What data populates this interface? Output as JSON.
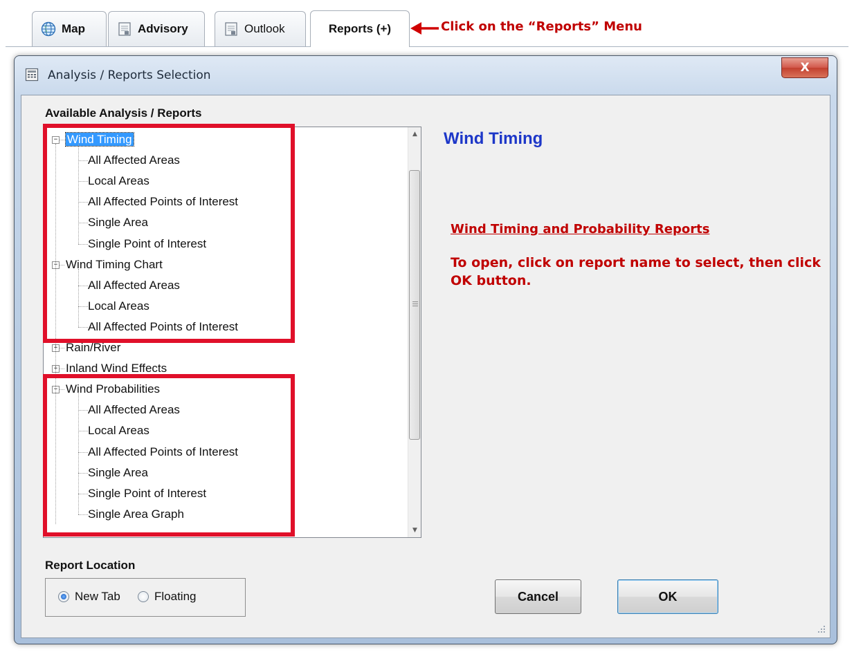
{
  "tabs": [
    {
      "label": "Map",
      "icon": "globe-icon",
      "bold": true
    },
    {
      "label": "Advisory",
      "icon": "document-icon",
      "bold": true
    },
    {
      "label": "Outlook",
      "icon": "document-icon",
      "bold": false
    },
    {
      "label": "Reports (+)",
      "icon": "",
      "bold": true,
      "active": true
    }
  ],
  "top_callout": "Click on the “Reports” Menu",
  "dialog": {
    "title": "Analysis / Reports Selection",
    "close_label": "X",
    "available_label": "Available Analysis / Reports",
    "tree": [
      {
        "label": "Wind Timing",
        "level": 0,
        "expander": "minus",
        "selected": true
      },
      {
        "label": "All Affected Areas",
        "level": 1
      },
      {
        "label": "Local Areas",
        "level": 1
      },
      {
        "label": "All Affected Points of Interest",
        "level": 1
      },
      {
        "label": "Single Area",
        "level": 1
      },
      {
        "label": "Single Point of Interest",
        "level": 1
      },
      {
        "label": "Wind Timing Chart",
        "level": 0,
        "expander": "minus"
      },
      {
        "label": "All Affected Areas",
        "level": 1
      },
      {
        "label": "Local Areas",
        "level": 1
      },
      {
        "label": "All Affected Points of Interest",
        "level": 1
      },
      {
        "label": "Rain/River",
        "level": 0,
        "expander": "plus"
      },
      {
        "label": "Inland Wind Effects",
        "level": 0,
        "expander": "plus"
      },
      {
        "label": "Wind Probabilities",
        "level": 0,
        "expander": "minus"
      },
      {
        "label": "All Affected Areas",
        "level": 1
      },
      {
        "label": "Local Areas",
        "level": 1
      },
      {
        "label": "All Affected Points of Interest",
        "level": 1
      },
      {
        "label": "Single Area",
        "level": 1
      },
      {
        "label": "Single Point of Interest",
        "level": 1
      },
      {
        "label": "Single Area Graph",
        "level": 1
      }
    ],
    "selected_report_title": "Wind Timing",
    "annotation_heading": "Wind Timing and Probability Reports",
    "annotation_body": "To open, click on report name to select, then click OK button.",
    "report_location_label": "Report Location",
    "location_options": [
      {
        "label": "New Tab",
        "checked": true
      },
      {
        "label": "Floating",
        "checked": false
      }
    ],
    "cancel_label": "Cancel",
    "ok_label": "OK"
  },
  "colors": {
    "annotation_red": "#c00000",
    "highlight_box": "#e0102a",
    "report_title_blue": "#1d37c8",
    "selection_blue": "#3399ff"
  }
}
